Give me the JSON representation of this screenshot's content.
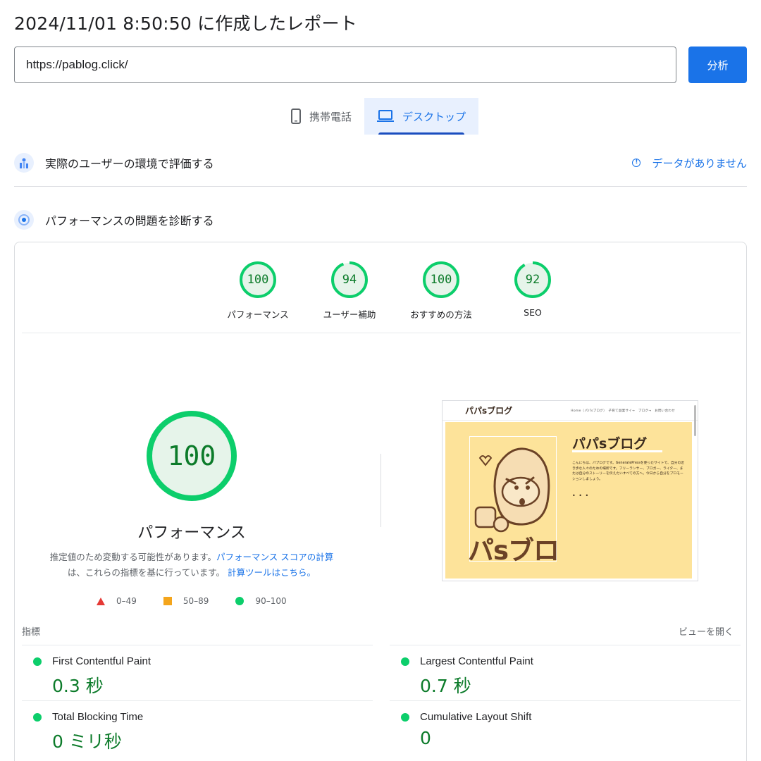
{
  "header": {
    "report_title": "2024/11/01 8:50:50 に作成したレポート"
  },
  "url_bar": {
    "value": "https://pablog.click/",
    "analyze_label": "分析"
  },
  "device_tabs": [
    {
      "label": "携帯電話",
      "icon": "phone-icon",
      "active": false
    },
    {
      "label": "デスクトップ",
      "icon": "desktop-icon",
      "active": true
    }
  ],
  "field_data": {
    "label": "実際のユーザーの環境で評価する",
    "no_data": "データがありません"
  },
  "diagnose": {
    "label": "パフォーマンスの問題を診断する"
  },
  "scores": [
    {
      "value": "100",
      "label": "パフォーマンス",
      "fraction": 1.0
    },
    {
      "value": "94",
      "label": "ユーザー補助",
      "fraction": 0.94
    },
    {
      "value": "100",
      "label": "おすすめの方法",
      "fraction": 1.0
    },
    {
      "value": "92",
      "label": "SEO",
      "fraction": 0.92
    }
  ],
  "performance": {
    "score": "100",
    "fraction": 1.0,
    "title": "パフォーマンス",
    "note_prefix": "推定値のため変動する可能性があります。",
    "note_link1": "パフォーマンス スコアの計算",
    "note_middle": "は、これらの指標を基に行っています。",
    "note_link2": "計算ツールはこちら。"
  },
  "legend": [
    {
      "range": "0–49",
      "shape": "triangle",
      "color": "#e53935"
    },
    {
      "range": "50–89",
      "shape": "square",
      "color": "#f4a51c"
    },
    {
      "range": "90–100",
      "shape": "circle",
      "color": "#0cce6b"
    }
  ],
  "screenshot": {
    "logo": "パパsブログ",
    "nav": "Home（パパsブログ）　子育て副業サイ→　ブログ→　お問い合わせ",
    "title": "パパsブログ",
    "text": "こんにちは、パブログです。GeneratePressを使ったサイトで、自分の近き歩む人々のための場所です。フリーランサー、ブロガー、ライター、または自分のストーリーを伝えたいすべての方へ。今日から自分をプロモーションしましょう。",
    "more": "• • •",
    "big_text": "パsブロ"
  },
  "metrics_section": {
    "label": "指標",
    "open_view": "ビューを開く"
  },
  "metrics": [
    {
      "name": "First Contentful Paint",
      "value": "0.3 秒"
    },
    {
      "name": "Largest Contentful Paint",
      "value": "0.7 秒"
    },
    {
      "name": "Total Blocking Time",
      "value": "0 ミリ秒"
    },
    {
      "name": "Cumulative Layout Shift",
      "value": "0"
    }
  ],
  "colors": {
    "accent": "#1a73e8",
    "good": "#0cce6b",
    "good_text": "#0c7b2a"
  }
}
